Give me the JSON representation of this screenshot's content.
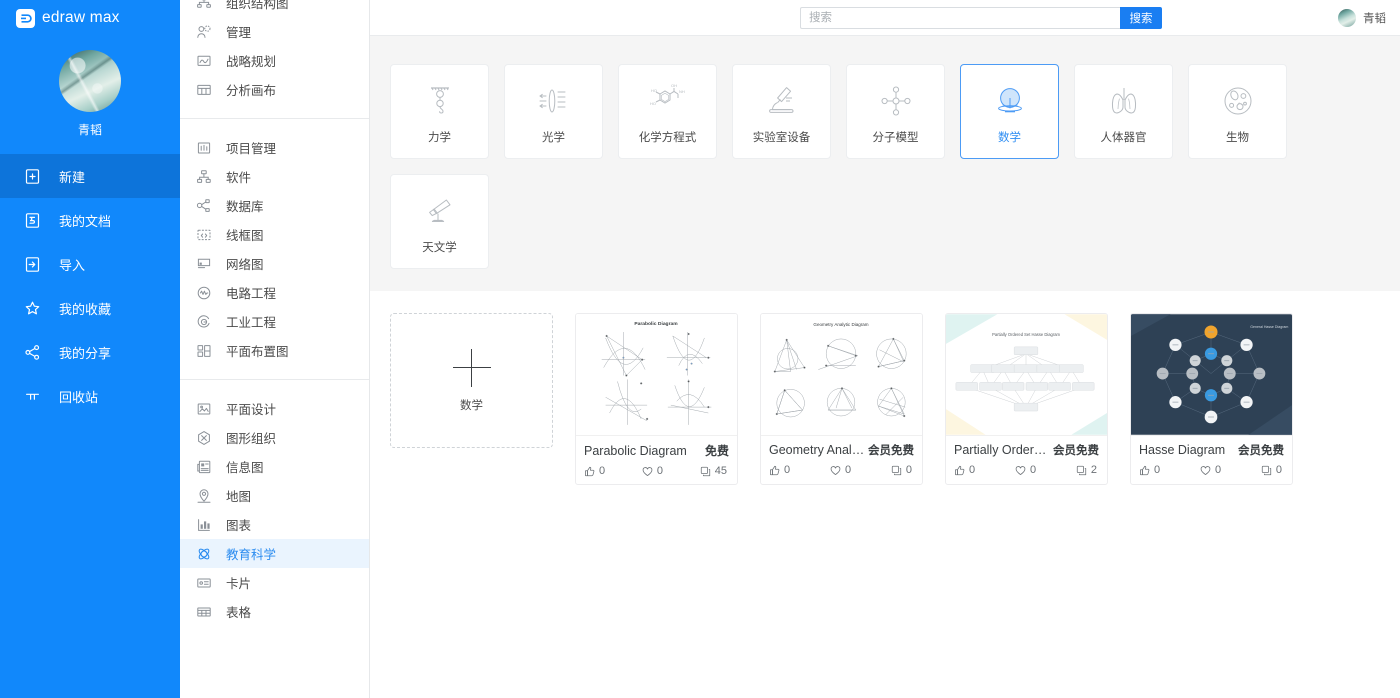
{
  "brand": {
    "name": "edraw max",
    "logo_icon": "edraw-logo-icon"
  },
  "sidebar": {
    "profile": {
      "name": "青韬",
      "avatar_icon": "user-avatar"
    },
    "items": [
      {
        "label": "新建",
        "icon": "new-file-icon",
        "active": true
      },
      {
        "label": "我的文档",
        "icon": "documents-icon",
        "active": false
      },
      {
        "label": "导入",
        "icon": "import-icon",
        "active": false
      },
      {
        "label": "我的收藏",
        "icon": "star-icon",
        "active": false
      },
      {
        "label": "我的分享",
        "icon": "share-icon",
        "active": false
      },
      {
        "label": "回收站",
        "icon": "trash-icon",
        "active": false
      }
    ]
  },
  "subnav": {
    "groups": [
      {
        "items": [
          {
            "label": "组织结构图",
            "icon": "org-chart-icon"
          },
          {
            "label": "管理",
            "icon": "management-icon"
          },
          {
            "label": "战略规划",
            "icon": "strategy-icon"
          },
          {
            "label": "分析画布",
            "icon": "canvas-icon"
          }
        ]
      },
      {
        "items": [
          {
            "label": "项目管理",
            "icon": "project-icon"
          },
          {
            "label": "软件",
            "icon": "software-icon"
          },
          {
            "label": "数据库",
            "icon": "database-icon"
          },
          {
            "label": "线框图",
            "icon": "wireframe-icon"
          },
          {
            "label": "网络图",
            "icon": "network-icon"
          },
          {
            "label": "电路工程",
            "icon": "circuit-icon"
          },
          {
            "label": "工业工程",
            "icon": "industrial-icon"
          },
          {
            "label": "平面布置图",
            "icon": "floorplan-icon"
          }
        ]
      },
      {
        "items": [
          {
            "label": "平面设计",
            "icon": "graphic-design-icon"
          },
          {
            "label": "图形组织",
            "icon": "graphic-organizer-icon"
          },
          {
            "label": "信息图",
            "icon": "infographic-icon"
          },
          {
            "label": "地图",
            "icon": "map-icon"
          },
          {
            "label": "图表",
            "icon": "chart-icon"
          },
          {
            "label": "教育科学",
            "icon": "science-icon",
            "active": true
          },
          {
            "label": "卡片",
            "icon": "card-icon"
          },
          {
            "label": "表格",
            "icon": "table-icon"
          }
        ]
      }
    ]
  },
  "topbar": {
    "search": {
      "placeholder": "搜索",
      "value": "",
      "button_label": "搜索",
      "button_color": "#1a7ef2"
    },
    "user": {
      "name": "青韬",
      "avatar_icon": "user-avatar"
    }
  },
  "categories": [
    {
      "label": "力学",
      "icon": "mechanics-icon",
      "selected": false
    },
    {
      "label": "光学",
      "icon": "optics-icon",
      "selected": false
    },
    {
      "label": "化学方程式",
      "icon": "chemistry-icon",
      "selected": false
    },
    {
      "label": "实验室设备",
      "icon": "microscope-icon",
      "selected": false
    },
    {
      "label": "分子模型",
      "icon": "molecule-icon",
      "selected": false
    },
    {
      "label": "数学",
      "icon": "math-icon",
      "selected": true
    },
    {
      "label": "人体器官",
      "icon": "lungs-icon",
      "selected": false
    },
    {
      "label": "生物",
      "icon": "biology-icon",
      "selected": false
    },
    {
      "label": "天文学",
      "icon": "telescope-icon",
      "selected": false
    }
  ],
  "templates": {
    "new_card": {
      "label": "数学",
      "icon": "plus-icon"
    },
    "items": [
      {
        "title": "Parabolic Diagram",
        "thumb_title": "Parabolic Diagram",
        "price": "免费",
        "likes": "0",
        "favorites": "0",
        "uses": "45",
        "thumb_style": "parabolic"
      },
      {
        "title": "Geometry Analyti...",
        "thumb_title": "Geometry Analytic Diagram",
        "price": "会员免费",
        "likes": "0",
        "favorites": "0",
        "uses": "0",
        "thumb_style": "geometry"
      },
      {
        "title": "Partially Ordered ...",
        "thumb_title": "Partially Ordered Set Hasse Diagram",
        "price": "会员免费",
        "likes": "0",
        "favorites": "0",
        "uses": "2",
        "thumb_style": "poset"
      },
      {
        "title": "Hasse Diagram",
        "thumb_title": "General Hasse Diagram",
        "price": "会员免费",
        "likes": "0",
        "favorites": "0",
        "uses": "0",
        "thumb_style": "hasse"
      }
    ]
  },
  "colors": {
    "sidebar_blue": "#1188fb",
    "sidebar_active": "#0d74da",
    "accent": "#2b8cf0",
    "page_bg": "#f5f5f5"
  }
}
